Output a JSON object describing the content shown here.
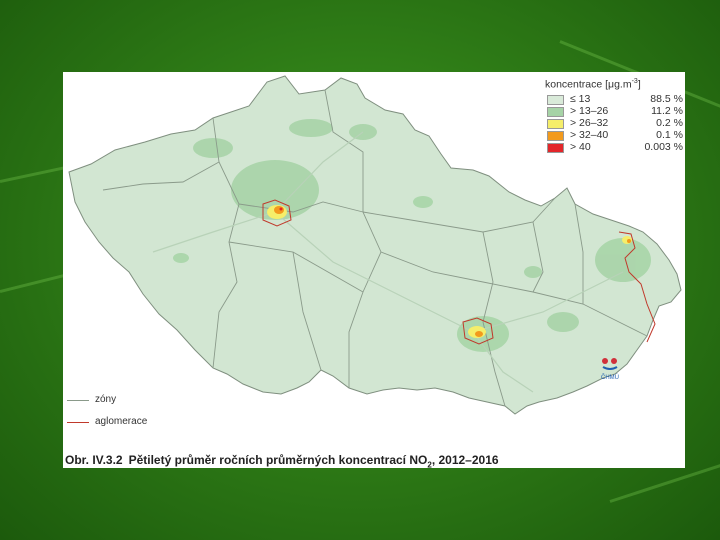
{
  "legend": {
    "title_prefix": "koncentrace [μg.m",
    "title_exp": "-3",
    "title_suffix": "]",
    "classes": [
      {
        "label": "≤ 13",
        "pct": "88.5 %",
        "color": "#d9ead9"
      },
      {
        "label": "> 13–26",
        "pct": "11.2 %",
        "color": "#a6d3a6"
      },
      {
        "label": "> 26–32",
        "pct": "0.2 %",
        "color": "#f5ee6a"
      },
      {
        "label": "> 32–40",
        "pct": "0.1 %",
        "color": "#f29a1d"
      },
      {
        "label": "> 40",
        "pct": "0.003 %",
        "color": "#e3262a"
      }
    ]
  },
  "line_legend": {
    "zones": "zóny",
    "agglomeration": "aglomerace"
  },
  "caption": {
    "number": "Obr. IV.3.2",
    "text": "Pětiletý průměr ročních průměrných koncentrací NO",
    "sub": "2",
    "years": ", 2012–2016"
  },
  "logo_text": "ČHMÚ",
  "colors": {
    "background_green": "#2f7d17",
    "map_fill": "#d2e6d2",
    "zone_border": "#8a9a8a",
    "agglomeration_line": "#c0392b"
  }
}
